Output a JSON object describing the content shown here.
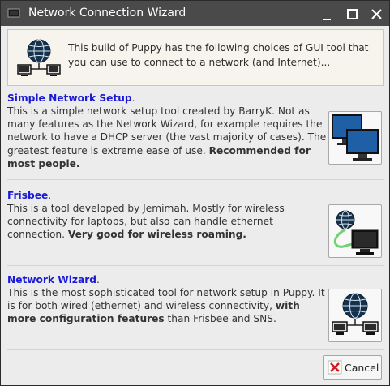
{
  "window": {
    "title": "Network Connection Wizard",
    "title_bar_color": "#4a4a4a"
  },
  "title_buttons": [
    "minimize-icon",
    "maximize-icon",
    "close-icon"
  ],
  "intro": {
    "text": "This build of Puppy has the following choices of GUI tool that you can use to connect to a network (and Internet)...",
    "icon": "network-globe-icon"
  },
  "tools": [
    {
      "title": "Simple Network Setup",
      "title_suffix": ".",
      "description": "This is a simple network setup tool created by BarryK. Not as many features as the Network Wizard, for example requires the network to have a DHCP server (the vast majority of cases). The greatest feature is extreme ease of use.",
      "emphasis": "Recommended for most people.",
      "icon": "two-monitors-icon"
    },
    {
      "title": "Frisbee",
      "title_suffix": ".",
      "description": "This is a tool developed by Jemimah. Mostly for wireless connectivity for laptops, but also can handle ethernet connection.",
      "emphasis": "Very good for wireless roaming.",
      "icon": "frisbee-icon"
    },
    {
      "title": "Network Wizard",
      "title_suffix": ".",
      "description": "This is the most sophisticated tool for network setup in Puppy. It is for both wired (ethernet) and wireless connectivity,",
      "emphasis": "with more configuration features",
      "description_end": "than Frisbee and SNS.",
      "icon": "network-wizard-icon"
    }
  ],
  "cancel_button": {
    "label": "Cancel",
    "icon": "cancel-icon"
  },
  "colors": {
    "link_title": "#1a1ad6",
    "monitor_blue": "#1f5fa6",
    "globe_dark": "#14324d"
  }
}
